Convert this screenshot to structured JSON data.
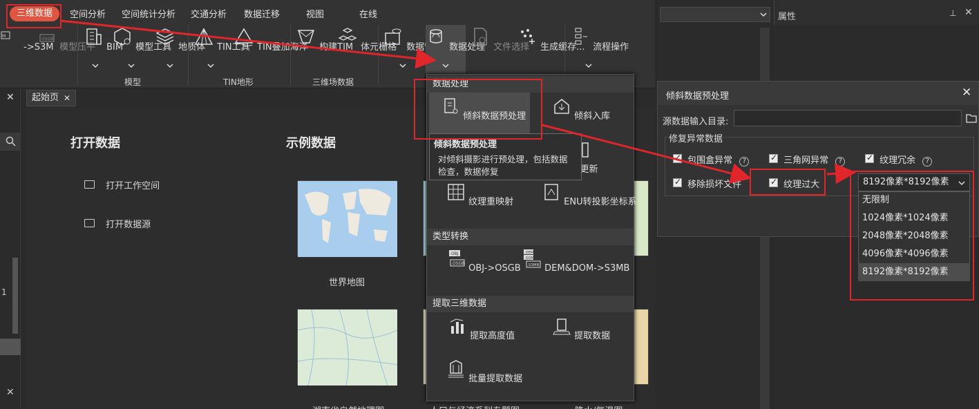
{
  "menubar": {
    "tabs": [
      "三维数据",
      "空间分析",
      "空间统计分析",
      "交通分析",
      "数据迁移",
      "视图",
      "在线"
    ],
    "active_tab": "三维数据"
  },
  "ribbon": {
    "left_partial": {
      "s3m": "->S3M",
      "compress": "模型压平"
    },
    "items": {
      "bim": "BIM",
      "model_tools": "模型工具",
      "geo_body": "地质体",
      "tin_tools": "TIN工具",
      "tin_sea": "TIN叠加海洋",
      "build_tim": "构建TIM",
      "voxel": "体元栅格",
      "data_manage": "数据管理",
      "data_process": "数据处理",
      "file_select": "文件选择",
      "gen_cache": "生成缓存...",
      "flow_ops": "流程操作"
    },
    "groups": {
      "model": "模型",
      "tin": "TIN地形",
      "field": "三维场数据"
    }
  },
  "right_panel": {
    "attr_title": "属性"
  },
  "workspace": {
    "start_tab": "起始页",
    "open_data_title": "打开数据",
    "examples_title": "示例数据",
    "open_workspace": "打开工作空间",
    "open_datasource": "打开数据源",
    "examples": [
      "世界地图",
      "湖南省自然地理图",
      "人口与经济系列专题图",
      "降水/气温图"
    ],
    "left_value": "1"
  },
  "dropdown": {
    "sections": {
      "process": "数据处理",
      "type_convert": "类型转换",
      "extract": "提取三维数据"
    },
    "items": {
      "preprocess": "倾斜数据预处理",
      "to_store": "倾斜入库",
      "update": "据更新",
      "retex": "纹理重映射",
      "enu": "ENU转投影坐标系",
      "obj_osgb": "OBJ->OSGB",
      "dem_s3mb": "DEM&DOM->S3MB",
      "extract_height": "提取高度值",
      "extract_data": "提取数据",
      "batch_extract": "批量提取数据"
    },
    "icon_labels": {
      "obj": ".OBJ",
      "osgb": ".OSGB",
      "dem": ".DEM",
      "dom": ".DOM",
      "s3mb": ".S3MB"
    },
    "tooltip": {
      "title": "倾斜数据预处理",
      "body_line1": "对倾斜摄影进行预处理，包括数据",
      "body_line2": "检查，数据修复"
    }
  },
  "dialog": {
    "title": "倾斜数据预处理",
    "source_label": "源数据输入目录:",
    "source_value": "",
    "group_title": "修复异常数据",
    "checks": {
      "bbox": "包围盒异常",
      "tri": "三角网异常",
      "tex_redundant": "纹理冗余",
      "remove_broken": "移除损坏文件",
      "tex_large": "纹理过大"
    },
    "select_value": "8192像素*8192像素",
    "options": [
      "无限制",
      "1024像素*1024像素",
      "2048像素*2048像素",
      "4096像素*4096像素",
      "8192像素*8192像素"
    ],
    "selected_option": "8192像素*8192像素"
  },
  "colors": {
    "active_tab": "#e0553f",
    "annotation": "#e0262a",
    "panel": "#333333"
  }
}
